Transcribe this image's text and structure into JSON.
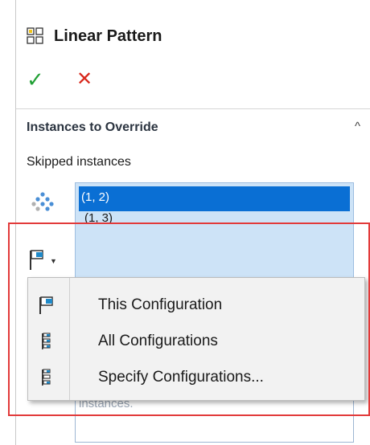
{
  "panel": {
    "title": "Linear Pattern",
    "title_icon": "linear-pattern-icon",
    "ok_symbol": "✓",
    "cancel_symbol": "✕"
  },
  "section": {
    "title": "Instances to Override",
    "collapse_symbol": "^",
    "subtitle": "Skipped instances",
    "instances": [
      {
        "label": "(1, 2)",
        "selected": true
      },
      {
        "label": "(1, 3)",
        "selected": false
      }
    ],
    "lower_partial_text": "instances."
  },
  "dropdown_menu": {
    "items": [
      {
        "label": "This Configuration",
        "icon": "this-configuration-flag-icon"
      },
      {
        "label": "All Configurations",
        "icon": "all-configurations-tree-icon"
      },
      {
        "label": "Specify Configurations...",
        "icon": "specify-configurations-tree-icon"
      }
    ]
  },
  "colors": {
    "accent_selection": "#0a6fd4",
    "list_background": "#cde3f7",
    "ok": "#21a035",
    "cancel": "#d8281c",
    "highlight": "#e23a3a"
  }
}
